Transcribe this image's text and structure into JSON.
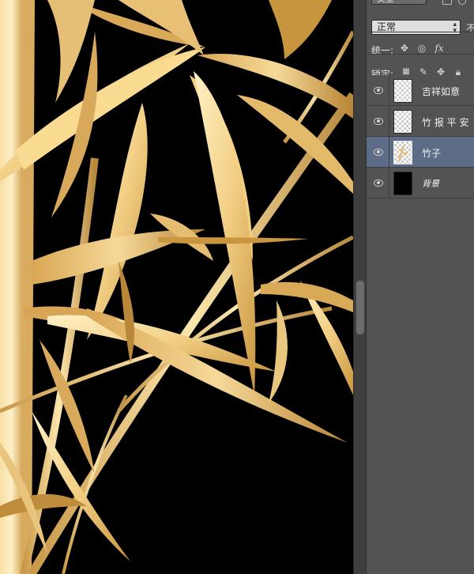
{
  "panel": {
    "kind_filter": "类型",
    "blend_mode": "正常",
    "opacity_label": "不",
    "unify_label": "统一:",
    "lock_label": "锁定:",
    "unify_icons": [
      "unify-position-icon",
      "unify-visibility-icon",
      "unify-style-icon"
    ],
    "lock_icons": [
      "lock-transparent-pixels-icon",
      "lock-image-pixels-icon",
      "lock-position-icon",
      "lock-all-icon"
    ]
  },
  "layers": [
    {
      "name": "吉祥如意",
      "visible": true,
      "thumbnail": "transparent",
      "selected": false
    },
    {
      "name": "竹 报 平 安",
      "visible": true,
      "thumbnail": "transparent",
      "selected": false
    },
    {
      "name": "竹子",
      "visible": true,
      "thumbnail": "bamboo",
      "selected": true
    },
    {
      "name": "背景",
      "visible": true,
      "thumbnail": "black",
      "selected": false
    }
  ],
  "colors": {
    "canvas_background": "#000000",
    "gold_light": "#fbe3a0",
    "gold_mid": "#e2b86a",
    "gold_dark": "#b98a3e",
    "panel_background": "#535353",
    "selected_layer": "#5e6d87"
  }
}
